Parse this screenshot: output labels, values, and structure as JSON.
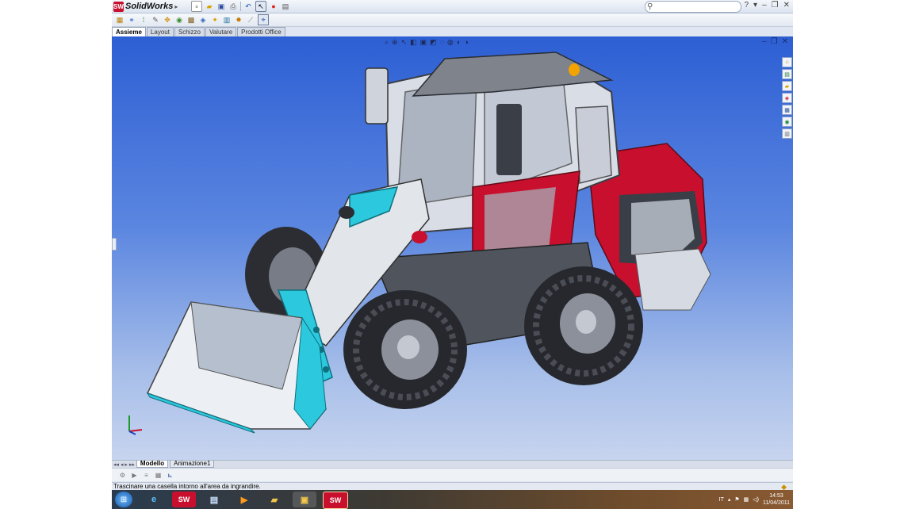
{
  "app": {
    "title": "SolidWorks",
    "logo_text": "SW",
    "search": {
      "placeholder": "",
      "value": ""
    },
    "window_controls": [
      "?",
      "▾",
      "–",
      "❐",
      "✕"
    ]
  },
  "tabs": [
    {
      "label": "Assieme",
      "active": true
    },
    {
      "label": "Layout",
      "active": false
    },
    {
      "label": "Schizzo",
      "active": false
    },
    {
      "label": "Valutare",
      "active": false
    },
    {
      "label": "Prodotti Office",
      "active": false
    }
  ],
  "model_tabs": [
    {
      "label": "Modello",
      "active": true
    },
    {
      "label": "Animazione1",
      "active": false
    }
  ],
  "status": {
    "text": "Trascinare una casella intorno all'area da ingrandire."
  },
  "taskbar": {
    "language": "IT",
    "time": "14:53",
    "date": "11/04/2011",
    "items": [
      "windows-start",
      "internet-explorer",
      "solidworks",
      "document",
      "media-player",
      "folder",
      "network-folder",
      "solidworks"
    ]
  },
  "colors": {
    "viewport_top": "#2d5fd4",
    "viewport_bottom": "#c7d4ef",
    "body_red": "#c8102e",
    "accent_cyan": "#2cc9de"
  }
}
